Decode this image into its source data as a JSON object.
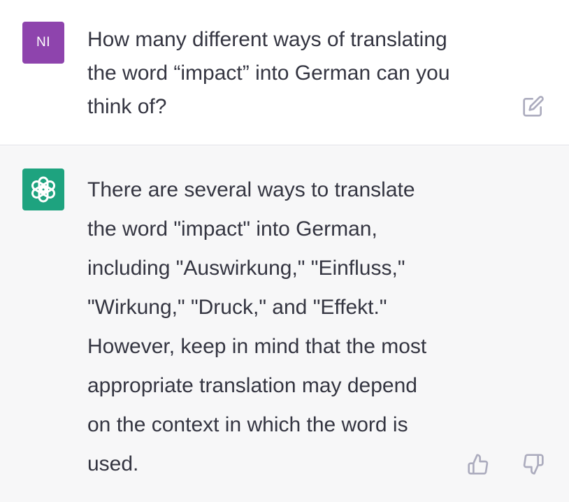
{
  "user_message": {
    "avatar_initials": "NI",
    "avatar_color": "#8e44ad",
    "text": "How many different ways of translating\nthe word “impact” into German can you\nthink of?",
    "edit_icon": "edit-icon"
  },
  "assistant_message": {
    "avatar_icon": "openai-logo-icon",
    "avatar_color": "#1ea37f",
    "text": "There are several ways to translate\nthe word \"impact\" into German,\nincluding \"Auswirkung,\" \"Einfluss,\"\n\"Wirkung,\" \"Druck,\" and \"Effekt.\"\nHowever, keep in mind that the most\nappropriate translation may depend\non the context in which the word is\nused.",
    "feedback_icons": [
      "thumbs-up-icon",
      "thumbs-down-icon"
    ]
  },
  "colors": {
    "text": "#343541",
    "assistant_background": "#f7f7f8",
    "icon": "#acacbe"
  }
}
